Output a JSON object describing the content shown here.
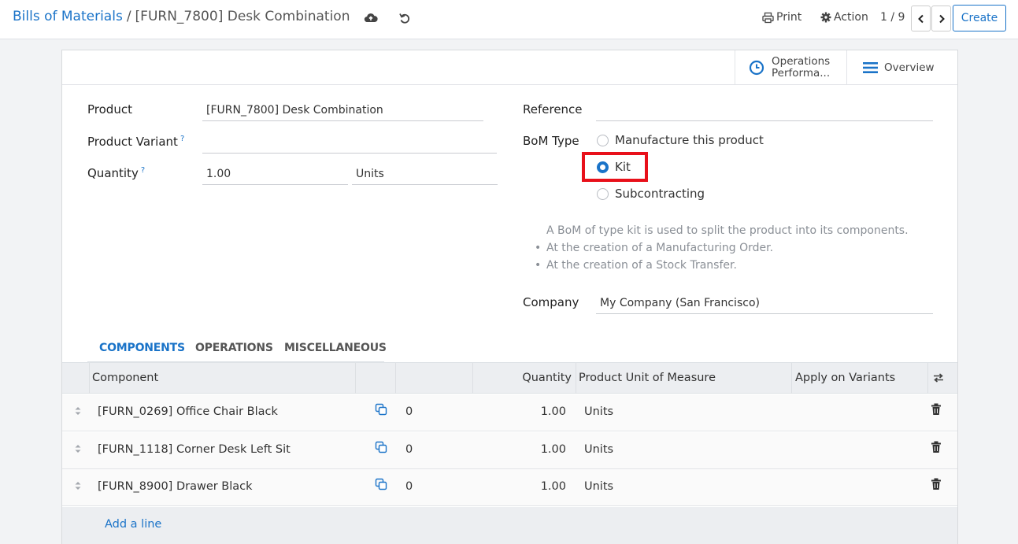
{
  "breadcrumb": {
    "parent": "Bills of Materials",
    "separator": "/",
    "current": "[FURN_7800] Desk Combination"
  },
  "toolbar": {
    "print_label": "Print",
    "action_label": "Action",
    "pager": "1 / 9",
    "create_label": "Create"
  },
  "smart_buttons": {
    "operations_line1": "Operations",
    "operations_line2": "Performa...",
    "overview": "Overview"
  },
  "form": {
    "product_label": "Product",
    "product_value": "[FURN_7800] Desk Combination",
    "variant_label": "Product Variant",
    "variant_value": "",
    "quantity_label": "Quantity",
    "quantity_value": "1.00",
    "uom_value": "Units",
    "help_mark": "?",
    "reference_label": "Reference",
    "reference_value": "",
    "bom_type_label": "BoM Type",
    "bom_type_options": [
      "Manufacture this product",
      "Kit",
      "Subcontracting"
    ],
    "bom_type_selected": "Kit",
    "help_text": "A BoM of type kit is used to split the product into its components.",
    "help_bullets": [
      "At the creation of a Manufacturing Order.",
      "At the creation of a Stock Transfer."
    ],
    "company_label": "Company",
    "company_value": "My Company (San Francisco)"
  },
  "tabs": [
    "COMPONENTS",
    "OPERATIONS",
    "MISCELLANEOUS"
  ],
  "table": {
    "headers": {
      "component": "Component",
      "quantity": "Quantity",
      "uom": "Product Unit of Measure",
      "variants": "Apply on Variants"
    },
    "rows": [
      {
        "component": "[FURN_0269] Office Chair Black",
        "count": "0",
        "quantity": "1.00",
        "uom": "Units"
      },
      {
        "component": "[FURN_1118] Corner Desk Left Sit",
        "count": "0",
        "quantity": "1.00",
        "uom": "Units"
      },
      {
        "component": "[FURN_8900] Drawer Black",
        "count": "0",
        "quantity": "1.00",
        "uom": "Units"
      }
    ],
    "add_line": "Add a line"
  },
  "colors": {
    "link": "#1a73c8",
    "highlight": "#e8101a"
  }
}
